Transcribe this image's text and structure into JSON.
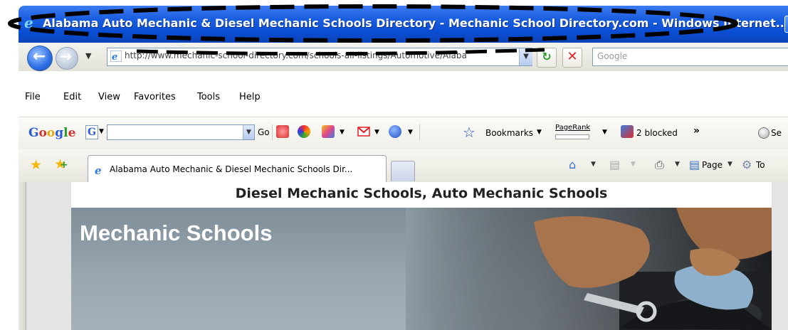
{
  "window": {
    "title": "Alabama Auto Mechanic & Diesel Mechanic Schools Directory - Mechanic School Directory.com - Windows Internet..."
  },
  "address_bar": {
    "url": "http://www.mechanic-school-directory.com/schools-all-listings/Automotive/Alaba",
    "search_placeholder": "Google"
  },
  "menu": {
    "items": [
      {
        "label": "File",
        "accel": "F"
      },
      {
        "label": "Edit",
        "accel": "E"
      },
      {
        "label": "View",
        "accel": "V"
      },
      {
        "label": "Favorites",
        "accel": "a"
      },
      {
        "label": "Tools",
        "accel": "T"
      },
      {
        "label": "Help",
        "accel": "H"
      }
    ]
  },
  "google_toolbar": {
    "logo": {
      "g1": "G",
      "o1": "o",
      "o2": "o",
      "g2": "g",
      "l": "l",
      "e": "e"
    },
    "g_button": "G",
    "go_label": "Go",
    "bookmarks_label": "Bookmarks",
    "pagerank_label": "PageRank",
    "blocked_label": "2 blocked",
    "more_label": "»",
    "search_label": "Se"
  },
  "tabs": {
    "active_label": "Alabama Auto Mechanic & Diesel Mechanic Schools Dir..."
  },
  "command_bar": {
    "page_label": "Page",
    "tools_label": "To"
  },
  "page": {
    "header": "Diesel Mechanic Schools, Auto Mechanic Schools",
    "hero_title": "Mechanic Schools"
  },
  "colors": {
    "title_bar": "#0a4ed4",
    "hero_bg": "#8c9ba5"
  }
}
